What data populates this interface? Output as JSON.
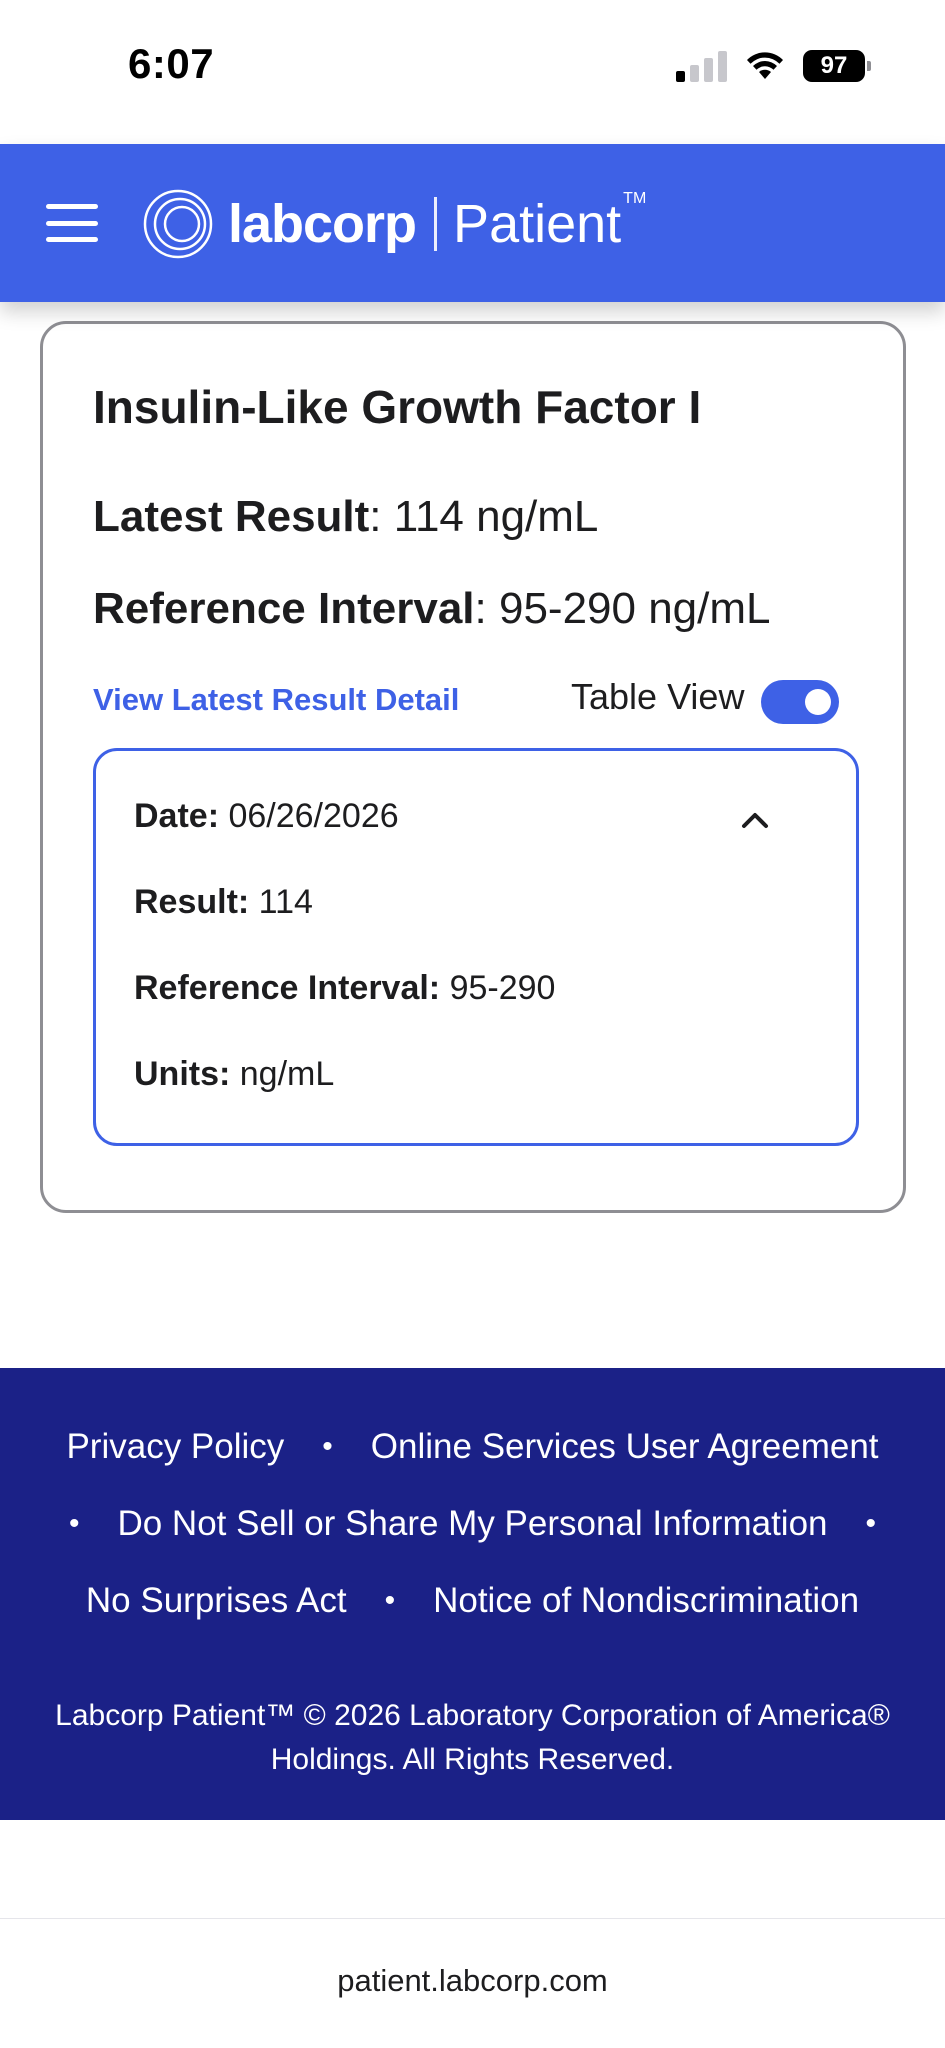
{
  "status_bar": {
    "time": "6:07",
    "battery": "97"
  },
  "header": {
    "menu_icon": "hamburger-menu-icon",
    "logo_word": "labcorp",
    "logo_product": "Patient",
    "logo_tm": "TM"
  },
  "card": {
    "title": "Insulin-Like Growth Factor I",
    "latest_result_label": "Latest Result",
    "latest_result_value": ": 114 ng/mL",
    "reference_interval_label": "Reference Interval",
    "reference_interval_value": ": 95-290 ng/mL",
    "detail_link": "View Latest Result Detail",
    "table_view_label": "Table View",
    "table_view_on": true
  },
  "result": {
    "date_label": "Date:",
    "date_value": " 06/26/2026",
    "result_label": "Result:",
    "result_value": " 114",
    "ref_label": "Reference Interval:",
    "ref_value": " 95-290",
    "units_label": "Units:",
    "units_value": " ng/mL"
  },
  "footer": {
    "privacy": "Privacy Policy",
    "agreement": "Online Services User Agreement",
    "do_not_sell": "Do Not Sell or Share My Personal Information",
    "no_surprises": "No Surprises Act",
    "nondiscrimination": "Notice of Nondiscrimination",
    "separator": "•",
    "copyright_line1": "Labcorp Patient™ © 2026 Laboratory Corporation of America®",
    "copyright_line2": "Holdings. All Rights Reserved."
  },
  "browser": {
    "url": "patient.labcorp.com"
  },
  "colors": {
    "brand_blue": "#3e61e6",
    "footer_navy": "#1b2187"
  }
}
